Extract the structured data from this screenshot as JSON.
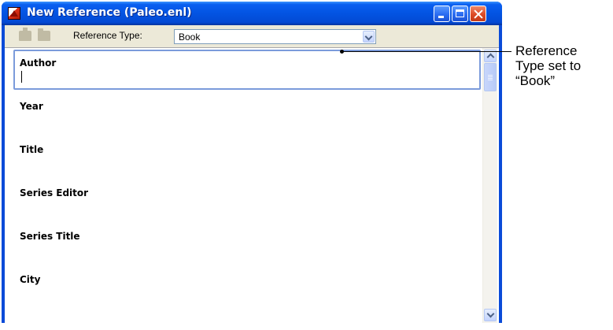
{
  "window": {
    "title": "New Reference (Paleo.enl)"
  },
  "toolbar": {
    "reference_type_label": "Reference Type:",
    "reference_type_value": "Book"
  },
  "fields": [
    {
      "label": "Author",
      "value": ""
    },
    {
      "label": "Year",
      "value": ""
    },
    {
      "label": "Title",
      "value": ""
    },
    {
      "label": "Series Editor",
      "value": ""
    },
    {
      "label": "Series Title",
      "value": ""
    },
    {
      "label": "City",
      "value": ""
    }
  ],
  "callout": {
    "lines": [
      "Reference",
      "Type set to",
      "“Book”"
    ]
  },
  "colors": {
    "titlebar": "#0354e2",
    "window_face": "#ece9d8",
    "close_button": "#dc4a25"
  }
}
